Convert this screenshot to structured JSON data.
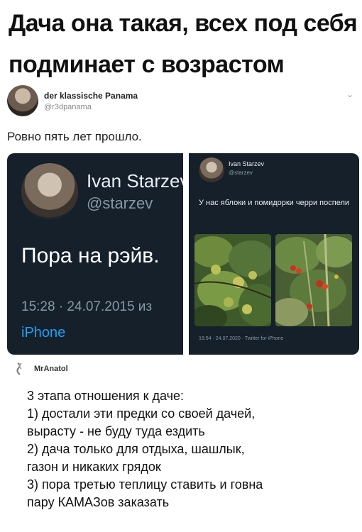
{
  "headline": {
    "line1": "Дача она такая, всех под себя",
    "line2": "подминает с возрастом"
  },
  "tweet": {
    "author_name": "der klassische Panama",
    "author_handle": "@r3dpanama",
    "text": "Ровно пять лет прошло."
  },
  "old_tweet": {
    "author_name": "Ivan Starzev",
    "author_handle": "@starzev",
    "text": "Пора на рэйв.",
    "meta": "15:28 · 24.07.2015 из",
    "device": "iPhone"
  },
  "new_tweet": {
    "author_name": "Ivan Starzev",
    "author_handle": "@starzev",
    "text": "У нас яблоки и помидорки черри поспели",
    "meta": "16:54 · 24.07.2020 · Twitter for iPhone"
  },
  "comment": {
    "username": "MrAnatol",
    "lines": [
      "3 этапа отношения к даче:",
      "1) достали эти предки со своей дачей,",
      "вырасту - не буду туда ездить",
      "2) дача только для отдыха, шашлык,",
      "газон и никаких грядок",
      "3) пора третью теплицу ставить и говна",
      "пару КАМАЗов заказать"
    ]
  },
  "colors": {
    "card_bg": "#15202b",
    "link_blue": "#1da1f2",
    "muted_text": "#8899a6"
  },
  "icons": [
    "chevron-down-icon",
    "user-avatar-icon",
    "comment-user-icon"
  ]
}
